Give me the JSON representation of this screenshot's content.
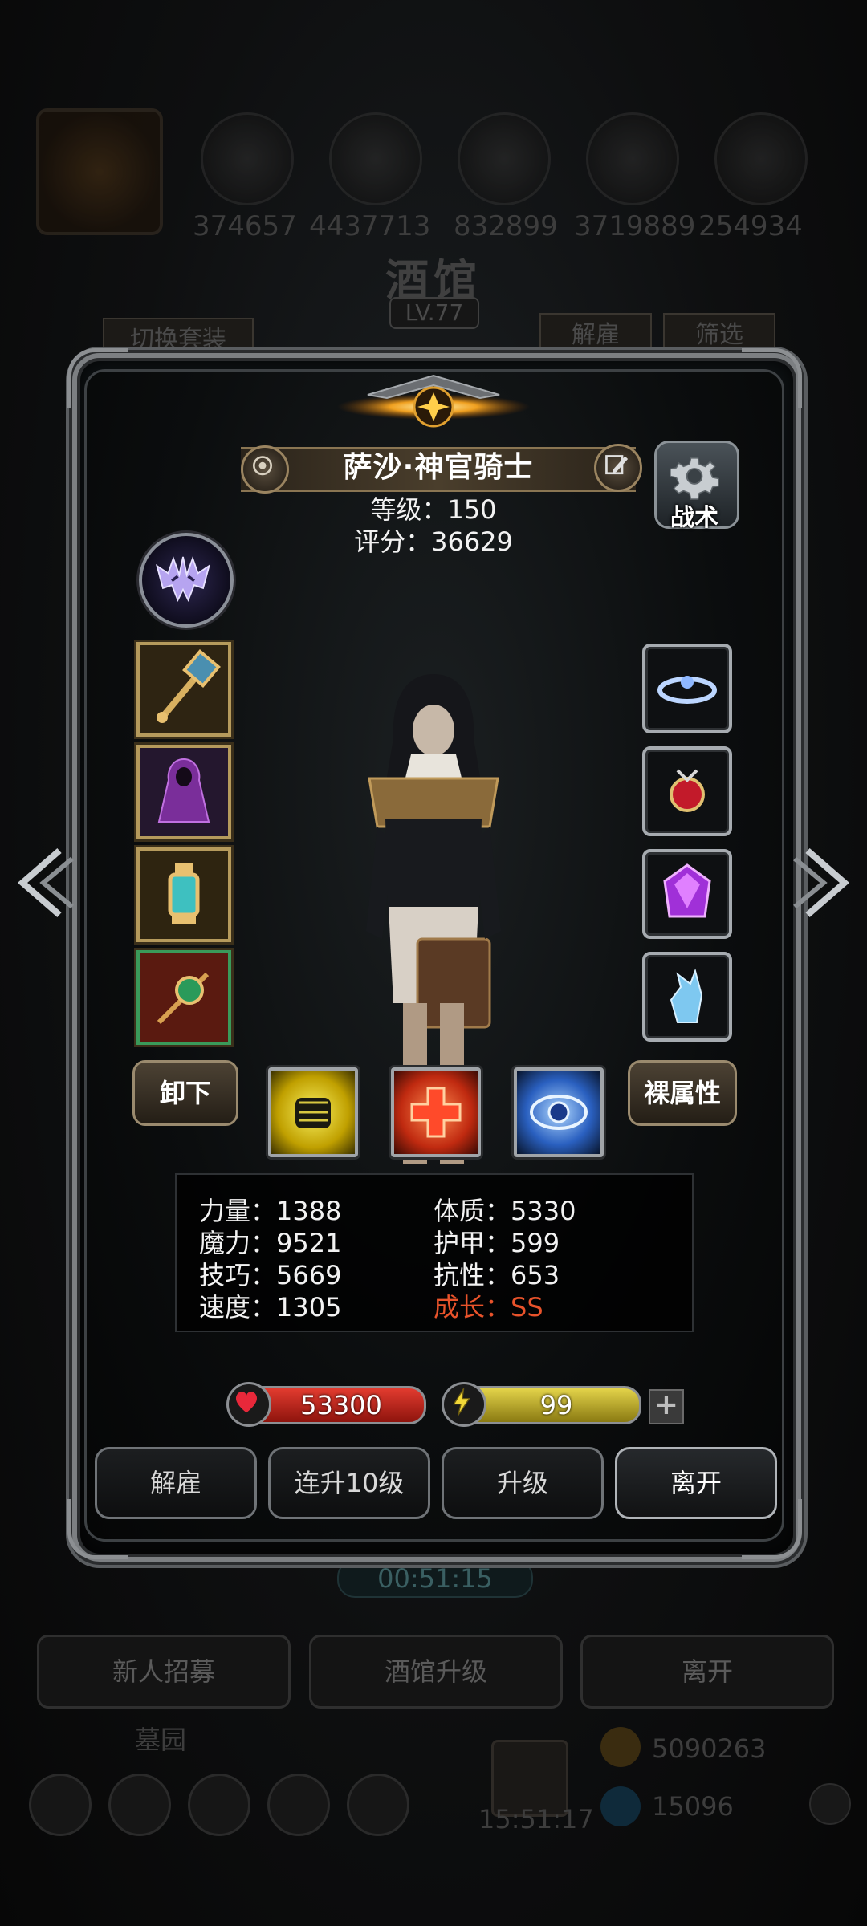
{
  "background": {
    "resource_values": [
      "374657",
      "4437713",
      "832899",
      "3719889",
      "254934"
    ],
    "title": "酒馆",
    "level": "LV.77",
    "switch_outfit_label": "切换套装",
    "dismiss_label": "解雇",
    "filter_label": "筛选",
    "timer": "00:51:15",
    "bottom_buttons": [
      "新人招募",
      "酒馆升级",
      "离开"
    ],
    "graveyard_label": "墓园",
    "clock": "15:51:17",
    "gold": "5090263",
    "gems": "15096"
  },
  "hero": {
    "name": "萨沙·神官骑士",
    "level_text": "等级：150",
    "score_text": "评分：36629",
    "tactic_label": "战术"
  },
  "actions": {
    "unequip_label": "卸下",
    "base_attr_label": "裸属性"
  },
  "stats": {
    "strength": "力量：1388",
    "constitution": "体质：5330",
    "magic": "魔力：9521",
    "armor": "护甲：599",
    "skill": "技巧：5669",
    "resistance": "抗性：653",
    "speed": "速度：1305",
    "growth": "成长：SS"
  },
  "bars": {
    "hp": "53300",
    "energy": "99",
    "plus": "+"
  },
  "buttons": {
    "dismiss": "解雇",
    "level_up_10": "连升10级",
    "level_up": "升级",
    "leave": "离开"
  },
  "colors": {
    "growth": "#e8532b",
    "gold_frame": "#b59a5c",
    "silver_frame": "#a6abb0"
  }
}
